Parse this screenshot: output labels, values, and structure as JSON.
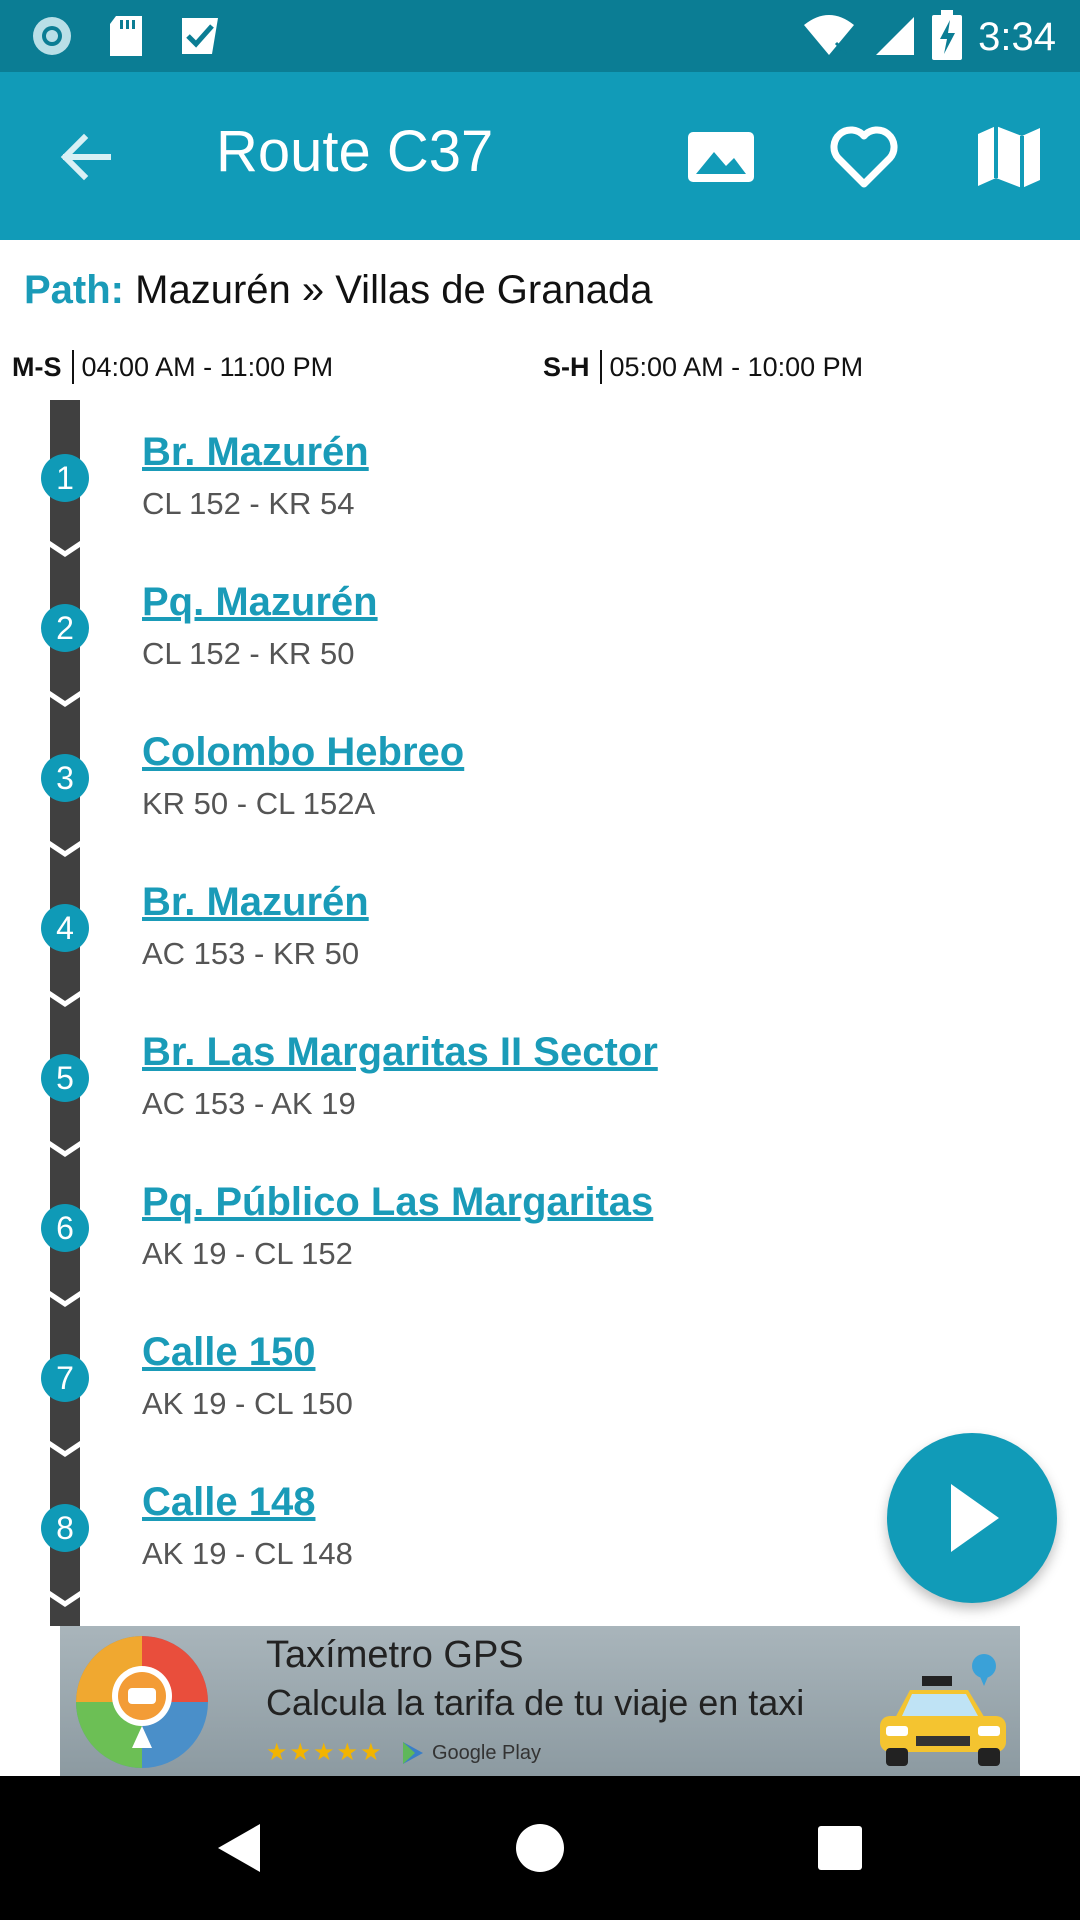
{
  "status_bar": {
    "time": "3:34",
    "icons": [
      "sync-icon",
      "sd-card-icon",
      "task-check-icon",
      "wifi-icon",
      "signal-icon",
      "battery-charging-icon"
    ]
  },
  "app_bar": {
    "title": "Route C37",
    "actions": [
      "image-icon",
      "favorite-heart-icon",
      "map-icon"
    ]
  },
  "path": {
    "label": "Path:",
    "value": "Mazurén » Villas de Granada"
  },
  "schedules": [
    {
      "days": "M-S",
      "hours": "04:00 AM - 11:00 PM"
    },
    {
      "days": "S-H",
      "hours": "05:00 AM - 10:00 PM"
    }
  ],
  "stops": [
    {
      "number": "1",
      "name": "Br. Mazurén",
      "address": "CL 152 - KR 54"
    },
    {
      "number": "2",
      "name": "Pq. Mazurén",
      "address": "CL 152 - KR 50"
    },
    {
      "number": "3",
      "name": "Colombo Hebreo",
      "address": "KR 50 - CL 152A"
    },
    {
      "number": "4",
      "name": "Br. Mazurén",
      "address": "AC 153 - KR 50"
    },
    {
      "number": "5",
      "name": "Br. Las Margaritas II Sector",
      "address": "AC 153 - AK 19"
    },
    {
      "number": "6",
      "name": "Pq. Público Las Margaritas",
      "address": "AK 19 - CL 152"
    },
    {
      "number": "7",
      "name": "Calle 150",
      "address": "AK 19 - CL 150"
    },
    {
      "number": "8",
      "name": "Calle 148",
      "address": "AK 19 - CL 148"
    }
  ],
  "ad": {
    "title": "Taxímetro GPS",
    "subtitle": "Calcula la tarifa de tu viaje en taxi",
    "stars": "★★★★★",
    "store": "Google Play"
  },
  "colors": {
    "accent": "#119bb8",
    "status_bar": "#0b7d94",
    "timeline": "#404040"
  }
}
